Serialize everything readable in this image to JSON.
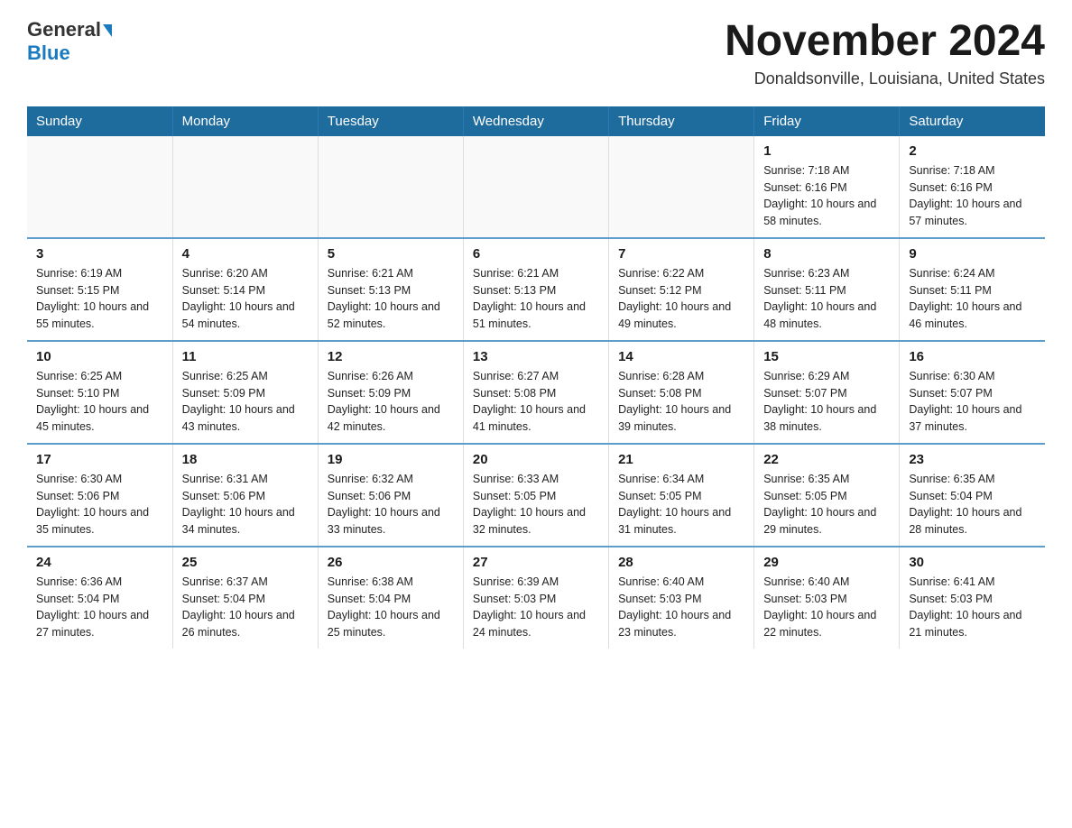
{
  "header": {
    "logo_general": "General",
    "logo_blue": "Blue",
    "month_title": "November 2024",
    "location": "Donaldsonville, Louisiana, United States"
  },
  "days_of_week": [
    "Sunday",
    "Monday",
    "Tuesday",
    "Wednesday",
    "Thursday",
    "Friday",
    "Saturday"
  ],
  "weeks": [
    [
      {
        "day": "",
        "info": ""
      },
      {
        "day": "",
        "info": ""
      },
      {
        "day": "",
        "info": ""
      },
      {
        "day": "",
        "info": ""
      },
      {
        "day": "",
        "info": ""
      },
      {
        "day": "1",
        "info": "Sunrise: 7:18 AM\nSunset: 6:16 PM\nDaylight: 10 hours and 58 minutes."
      },
      {
        "day": "2",
        "info": "Sunrise: 7:18 AM\nSunset: 6:16 PM\nDaylight: 10 hours and 57 minutes."
      }
    ],
    [
      {
        "day": "3",
        "info": "Sunrise: 6:19 AM\nSunset: 5:15 PM\nDaylight: 10 hours and 55 minutes."
      },
      {
        "day": "4",
        "info": "Sunrise: 6:20 AM\nSunset: 5:14 PM\nDaylight: 10 hours and 54 minutes."
      },
      {
        "day": "5",
        "info": "Sunrise: 6:21 AM\nSunset: 5:13 PM\nDaylight: 10 hours and 52 minutes."
      },
      {
        "day": "6",
        "info": "Sunrise: 6:21 AM\nSunset: 5:13 PM\nDaylight: 10 hours and 51 minutes."
      },
      {
        "day": "7",
        "info": "Sunrise: 6:22 AM\nSunset: 5:12 PM\nDaylight: 10 hours and 49 minutes."
      },
      {
        "day": "8",
        "info": "Sunrise: 6:23 AM\nSunset: 5:11 PM\nDaylight: 10 hours and 48 minutes."
      },
      {
        "day": "9",
        "info": "Sunrise: 6:24 AM\nSunset: 5:11 PM\nDaylight: 10 hours and 46 minutes."
      }
    ],
    [
      {
        "day": "10",
        "info": "Sunrise: 6:25 AM\nSunset: 5:10 PM\nDaylight: 10 hours and 45 minutes."
      },
      {
        "day": "11",
        "info": "Sunrise: 6:25 AM\nSunset: 5:09 PM\nDaylight: 10 hours and 43 minutes."
      },
      {
        "day": "12",
        "info": "Sunrise: 6:26 AM\nSunset: 5:09 PM\nDaylight: 10 hours and 42 minutes."
      },
      {
        "day": "13",
        "info": "Sunrise: 6:27 AM\nSunset: 5:08 PM\nDaylight: 10 hours and 41 minutes."
      },
      {
        "day": "14",
        "info": "Sunrise: 6:28 AM\nSunset: 5:08 PM\nDaylight: 10 hours and 39 minutes."
      },
      {
        "day": "15",
        "info": "Sunrise: 6:29 AM\nSunset: 5:07 PM\nDaylight: 10 hours and 38 minutes."
      },
      {
        "day": "16",
        "info": "Sunrise: 6:30 AM\nSunset: 5:07 PM\nDaylight: 10 hours and 37 minutes."
      }
    ],
    [
      {
        "day": "17",
        "info": "Sunrise: 6:30 AM\nSunset: 5:06 PM\nDaylight: 10 hours and 35 minutes."
      },
      {
        "day": "18",
        "info": "Sunrise: 6:31 AM\nSunset: 5:06 PM\nDaylight: 10 hours and 34 minutes."
      },
      {
        "day": "19",
        "info": "Sunrise: 6:32 AM\nSunset: 5:06 PM\nDaylight: 10 hours and 33 minutes."
      },
      {
        "day": "20",
        "info": "Sunrise: 6:33 AM\nSunset: 5:05 PM\nDaylight: 10 hours and 32 minutes."
      },
      {
        "day": "21",
        "info": "Sunrise: 6:34 AM\nSunset: 5:05 PM\nDaylight: 10 hours and 31 minutes."
      },
      {
        "day": "22",
        "info": "Sunrise: 6:35 AM\nSunset: 5:05 PM\nDaylight: 10 hours and 29 minutes."
      },
      {
        "day": "23",
        "info": "Sunrise: 6:35 AM\nSunset: 5:04 PM\nDaylight: 10 hours and 28 minutes."
      }
    ],
    [
      {
        "day": "24",
        "info": "Sunrise: 6:36 AM\nSunset: 5:04 PM\nDaylight: 10 hours and 27 minutes."
      },
      {
        "day": "25",
        "info": "Sunrise: 6:37 AM\nSunset: 5:04 PM\nDaylight: 10 hours and 26 minutes."
      },
      {
        "day": "26",
        "info": "Sunrise: 6:38 AM\nSunset: 5:04 PM\nDaylight: 10 hours and 25 minutes."
      },
      {
        "day": "27",
        "info": "Sunrise: 6:39 AM\nSunset: 5:03 PM\nDaylight: 10 hours and 24 minutes."
      },
      {
        "day": "28",
        "info": "Sunrise: 6:40 AM\nSunset: 5:03 PM\nDaylight: 10 hours and 23 minutes."
      },
      {
        "day": "29",
        "info": "Sunrise: 6:40 AM\nSunset: 5:03 PM\nDaylight: 10 hours and 22 minutes."
      },
      {
        "day": "30",
        "info": "Sunrise: 6:41 AM\nSunset: 5:03 PM\nDaylight: 10 hours and 21 minutes."
      }
    ]
  ]
}
